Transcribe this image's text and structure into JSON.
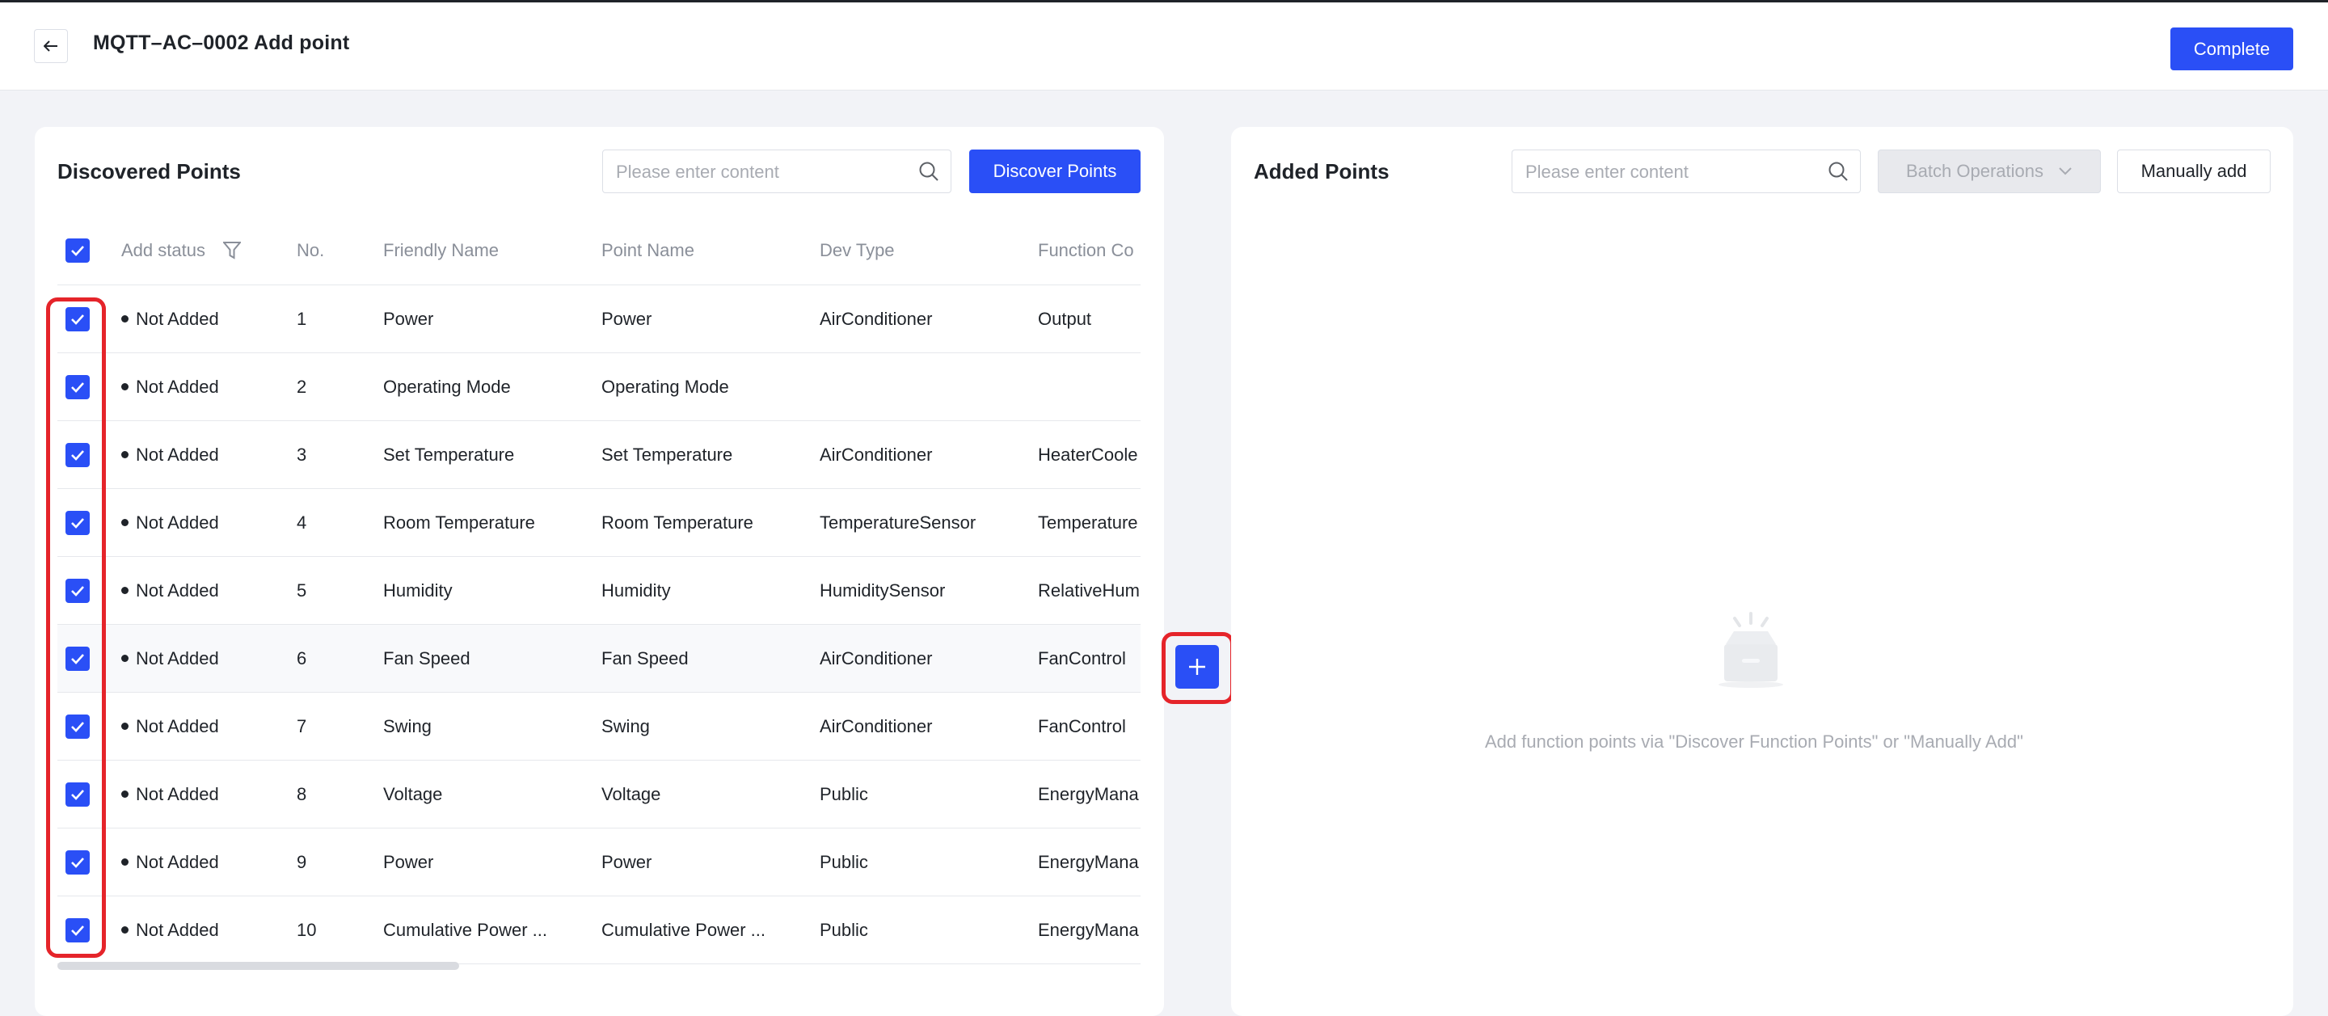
{
  "header": {
    "title": "MQTT–AC–0002 Add point",
    "complete_label": "Complete"
  },
  "discovered": {
    "title": "Discovered Points",
    "search_placeholder": "Please enter content",
    "discover_label": "Discover Points",
    "columns": {
      "status": "Add status",
      "no": "No.",
      "friendly": "Friendly Name",
      "point": "Point Name",
      "dev": "Dev Type",
      "func": "Function Co"
    },
    "rows": [
      {
        "status": "Not Added",
        "no": "1",
        "friendly": "Power",
        "point": "Power",
        "dev": "AirConditioner",
        "func": "Output"
      },
      {
        "status": "Not Added",
        "no": "2",
        "friendly": "Operating Mode",
        "point": "Operating Mode",
        "dev": "",
        "func": ""
      },
      {
        "status": "Not Added",
        "no": "3",
        "friendly": "Set Temperature",
        "point": "Set Temperature",
        "dev": "AirConditioner",
        "func": "HeaterCoole"
      },
      {
        "status": "Not Added",
        "no": "4",
        "friendly": "Room Temperature",
        "point": "Room Temperature",
        "dev": "TemperatureSensor",
        "func": "Temperature"
      },
      {
        "status": "Not Added",
        "no": "5",
        "friendly": "Humidity",
        "point": "Humidity",
        "dev": "HumiditySensor",
        "func": "RelativeHum"
      },
      {
        "status": "Not Added",
        "no": "6",
        "friendly": "Fan Speed",
        "point": "Fan Speed",
        "dev": "AirConditioner",
        "func": "FanControl"
      },
      {
        "status": "Not Added",
        "no": "7",
        "friendly": "Swing",
        "point": "Swing",
        "dev": "AirConditioner",
        "func": "FanControl"
      },
      {
        "status": "Not Added",
        "no": "8",
        "friendly": "Voltage",
        "point": "Voltage",
        "dev": "Public",
        "func": "EnergyMana"
      },
      {
        "status": "Not Added",
        "no": "9",
        "friendly": "Power",
        "point": "Power",
        "dev": "Public",
        "func": "EnergyMana"
      },
      {
        "status": "Not Added",
        "no": "10",
        "friendly": "Cumulative Power ...",
        "point": "Cumulative Power ...",
        "dev": "Public",
        "func": "EnergyMana"
      }
    ]
  },
  "added": {
    "title": "Added Points",
    "search_placeholder": "Please enter content",
    "batch_label": "Batch Operations",
    "manual_label": "Manually add",
    "empty_text": "Add function points via \"Discover Function Points\" or \"Manually Add\""
  },
  "colors": {
    "primary": "#2a4ff6",
    "highlight": "#e5242a",
    "background": "#f2f3f7"
  },
  "icons": [
    "back-arrow-icon",
    "search-icon",
    "filter-icon",
    "check-icon",
    "plus-icon",
    "chevron-down-icon",
    "empty-box-icon"
  ]
}
